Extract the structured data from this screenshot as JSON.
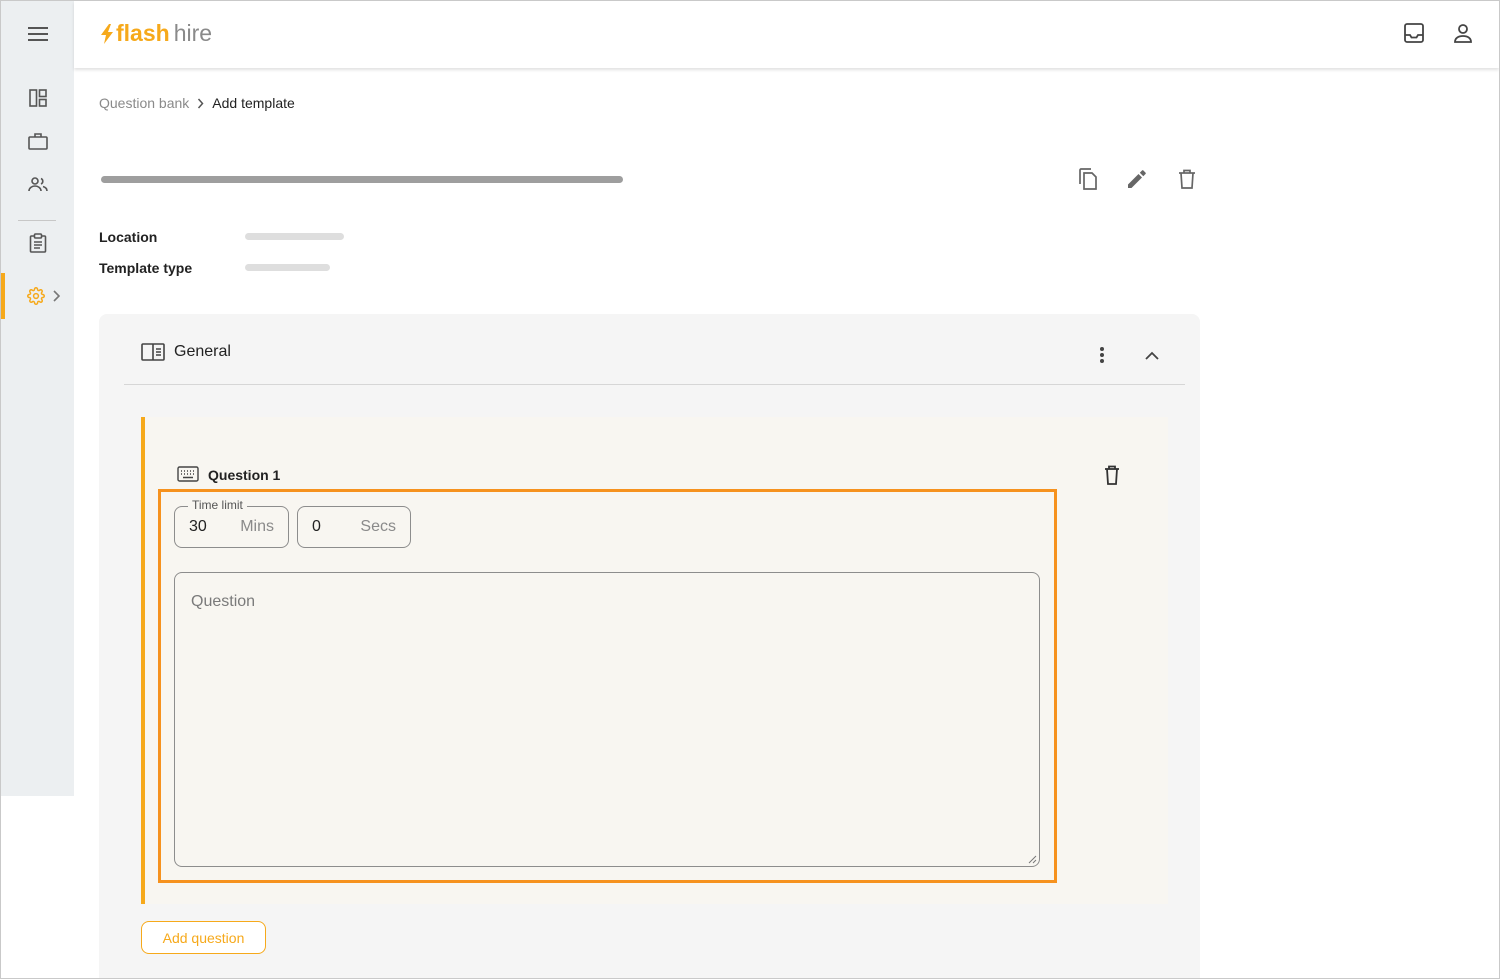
{
  "brand": {
    "part1": "flash",
    "part2": "hire",
    "accent": "#f6a91b"
  },
  "header": {
    "icons": [
      "inbox-icon",
      "account-icon"
    ]
  },
  "sidebar": {
    "items": [
      {
        "name": "menu",
        "icon": "hamburger-icon"
      },
      {
        "name": "dashboard",
        "icon": "dashboard-icon"
      },
      {
        "name": "jobs",
        "icon": "briefcase-icon"
      },
      {
        "name": "people",
        "icon": "people-icon"
      },
      {
        "name": "templates",
        "icon": "clipboard-icon"
      },
      {
        "name": "settings",
        "icon": "gear-icon",
        "active": true
      }
    ]
  },
  "breadcrumb": {
    "parent": "Question bank",
    "current": "Add template"
  },
  "info": {
    "location_label": "Location",
    "type_label": "Template type"
  },
  "section": {
    "title": "General",
    "question": {
      "title": "Question 1",
      "time_limit_label": "Time limit",
      "minutes_value": "30",
      "minutes_unit": "Mins",
      "seconds_value": "0",
      "seconds_unit": "Secs",
      "question_placeholder": "Question"
    },
    "add_question_label": "Add question"
  }
}
